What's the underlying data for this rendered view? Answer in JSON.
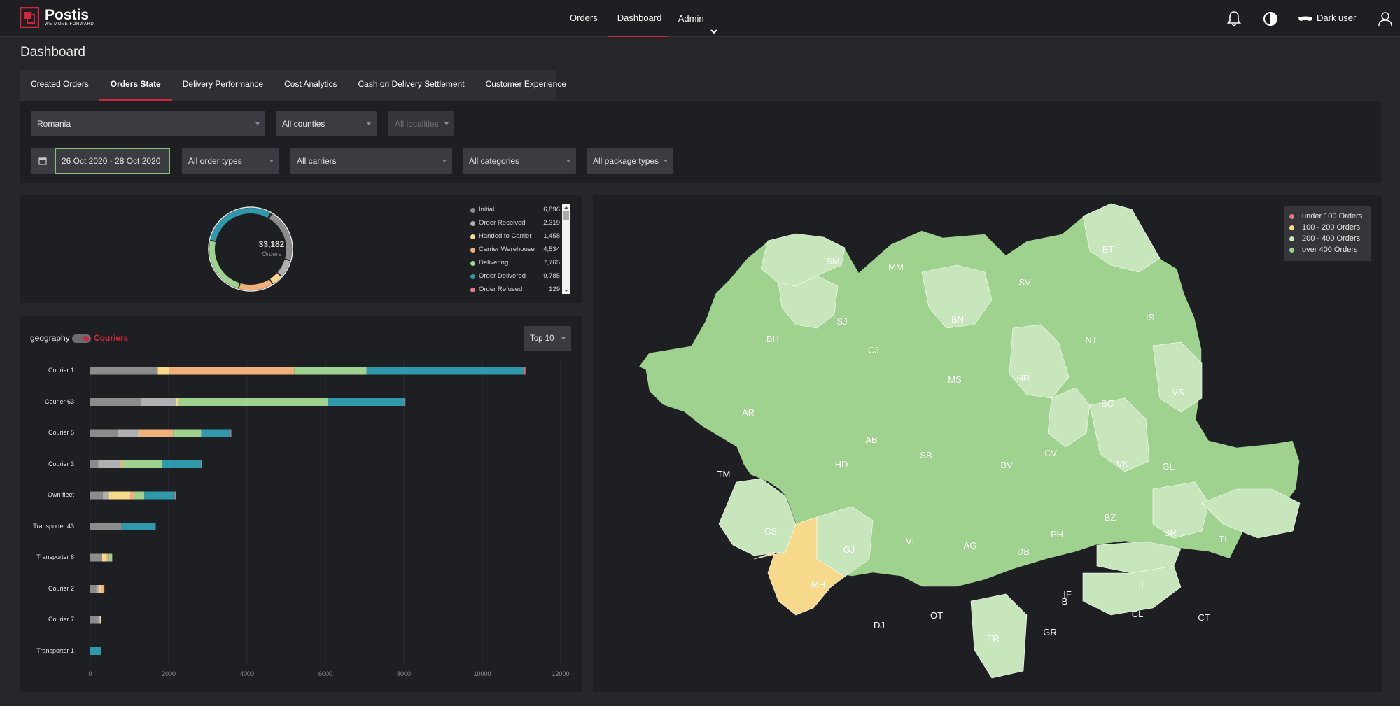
{
  "app": {
    "logo_name": "Postis",
    "logo_tagline": "WE MOVE FORWARD"
  },
  "topnav": {
    "items": [
      {
        "label": "Orders"
      },
      {
        "label": "Dashboard",
        "active": true
      },
      {
        "label": "Admin"
      }
    ]
  },
  "user": {
    "name": "Dark user",
    "icons": [
      "bell-icon",
      "contrast-icon",
      "mask-icon",
      "user-icon"
    ]
  },
  "page": {
    "title": "Dashboard"
  },
  "tabs": [
    {
      "label": "Created Orders"
    },
    {
      "label": "Orders State",
      "active": true
    },
    {
      "label": "Delivery Performance"
    },
    {
      "label": "Cost Analytics"
    },
    {
      "label": "Cash on Delivery Settlement"
    },
    {
      "label": "Customer Experience"
    }
  ],
  "filters": {
    "country": "Romania",
    "counties": "All counties",
    "localities": "All localities",
    "date_range": "26 Oct 2020 - 28 Oct 2020",
    "order_types": "All order types",
    "carriers": "All carriers",
    "categories": "All categories",
    "package_types": "All package types"
  },
  "donut": {
    "total": "33,182",
    "total_label": "Orders",
    "legend": [
      {
        "name": "Initial",
        "value": "6,896",
        "color": "#8c8c8c"
      },
      {
        "name": "Order Received",
        "value": "2,319",
        "color": "#b0b0b0"
      },
      {
        "name": "Handed to Carrier",
        "value": "1,458",
        "color": "#f6d98a"
      },
      {
        "name": "Carrier Warehouse",
        "value": "4,534",
        "color": "#f0b07c"
      },
      {
        "name": "Delivering",
        "value": "7,765",
        "color": "#9fd18f"
      },
      {
        "name": "Order Delivered",
        "value": "9,785",
        "color": "#2f98aa"
      },
      {
        "name": "Order Refused",
        "value": "129",
        "color": "#e07a84"
      }
    ]
  },
  "bar_panel": {
    "geography_label": "geography",
    "couriers_label": "Couriers",
    "top_select": "Top 10"
  },
  "chart_data": {
    "type": "bar",
    "orientation": "horizontal",
    "stacked": true,
    "categories": [
      "Courier 1",
      "Courier 63",
      "Courier 5",
      "Courier 3",
      "Own fleet",
      "Transporter 43",
      "Transporter 6",
      "Courier 2",
      "Courier 7",
      "Transporter 1"
    ],
    "series": [
      {
        "name": "Initial",
        "color": "#8c8c8c",
        "values": [
          1720,
          1300,
          700,
          200,
          320,
          800,
          300,
          150,
          200,
          0
        ]
      },
      {
        "name": "Order Received",
        "color": "#b0b0b0",
        "values": [
          0,
          880,
          520,
          550,
          150,
          0,
          0,
          80,
          50,
          0
        ]
      },
      {
        "name": "Handed to Carrier",
        "color": "#f6d98a",
        "values": [
          280,
          80,
          40,
          0,
          560,
          0,
          100,
          50,
          30,
          0
        ]
      },
      {
        "name": "Carrier Warehouse",
        "color": "#f0b07c",
        "values": [
          3200,
          0,
          850,
          80,
          80,
          0,
          70,
          80,
          0,
          0
        ]
      },
      {
        "name": "Delivering",
        "color": "#9fd18f",
        "values": [
          1850,
          3800,
          720,
          1000,
          270,
          0,
          90,
          0,
          0,
          0
        ]
      },
      {
        "name": "Order Delivered",
        "color": "#2f98aa",
        "values": [
          4000,
          1950,
          750,
          1000,
          780,
          870,
          0,
          0,
          0,
          280
        ]
      },
      {
        "name": "Order Refused",
        "color": "#e07a84",
        "values": [
          50,
          30,
          10,
          10,
          10,
          0,
          0,
          0,
          0,
          0
        ]
      }
    ],
    "xlim": [
      0,
      12000
    ],
    "xticks": [
      "0",
      "2000",
      "4000",
      "6000",
      "8000",
      "10000",
      "12000"
    ],
    "grid": true
  },
  "map": {
    "legend": [
      {
        "label": "under 100 Orders",
        "color": "#e07a84"
      },
      {
        "label": "100 - 200 Orders",
        "color": "#f6d98a"
      },
      {
        "label": "200 - 400 Orders",
        "color": "#c7e6bc"
      },
      {
        "label": "over 400 Orders",
        "color": "#9fd18f"
      }
    ],
    "counties": [
      {
        "code": "SM",
        "tier": "200-400"
      },
      {
        "code": "MM",
        "tier": "over 400"
      },
      {
        "code": "SV",
        "tier": "over 400"
      },
      {
        "code": "BT",
        "tier": "200-400"
      },
      {
        "code": "SJ",
        "tier": "200-400"
      },
      {
        "code": "BN",
        "tier": "200-400"
      },
      {
        "code": "IS",
        "tier": "over 400"
      },
      {
        "code": "BH",
        "tier": "over 400"
      },
      {
        "code": "CJ",
        "tier": "over 400"
      },
      {
        "code": "NT",
        "tier": "over 400"
      },
      {
        "code": "MS",
        "tier": "over 400"
      },
      {
        "code": "HR",
        "tier": "200-400"
      },
      {
        "code": "VS",
        "tier": "200-400"
      },
      {
        "code": "BC",
        "tier": "over 400"
      },
      {
        "code": "AR",
        "tier": "over 400"
      },
      {
        "code": "AB",
        "tier": "over 400"
      },
      {
        "code": "HD",
        "tier": "over 400"
      },
      {
        "code": "SB",
        "tier": "over 400"
      },
      {
        "code": "BV",
        "tier": "over 400"
      },
      {
        "code": "CV",
        "tier": "200-400"
      },
      {
        "code": "VN",
        "tier": "200-400"
      },
      {
        "code": "GL",
        "tier": "over 400"
      },
      {
        "code": "TM",
        "tier": "over 400"
      },
      {
        "code": "CS",
        "tier": "200-400"
      },
      {
        "code": "GJ",
        "tier": "200-400"
      },
      {
        "code": "VL",
        "tier": "over 400"
      },
      {
        "code": "AG",
        "tier": "over 400"
      },
      {
        "code": "DB",
        "tier": "over 400"
      },
      {
        "code": "PH",
        "tier": "over 400"
      },
      {
        "code": "BZ",
        "tier": "over 400"
      },
      {
        "code": "BR",
        "tier": "200-400"
      },
      {
        "code": "TL",
        "tier": "200-400"
      },
      {
        "code": "MH",
        "tier": "100-200"
      },
      {
        "code": "IF",
        "tier": "over 400"
      },
      {
        "code": "B",
        "tier": "over 400"
      },
      {
        "code": "IL",
        "tier": "200-400"
      },
      {
        "code": "DJ",
        "tier": "over 400"
      },
      {
        "code": "OT",
        "tier": "over 400"
      },
      {
        "code": "CL",
        "tier": "200-400"
      },
      {
        "code": "CT",
        "tier": "over 400"
      },
      {
        "code": "TR",
        "tier": "200-400"
      },
      {
        "code": "GR",
        "tier": "over 400"
      }
    ]
  }
}
